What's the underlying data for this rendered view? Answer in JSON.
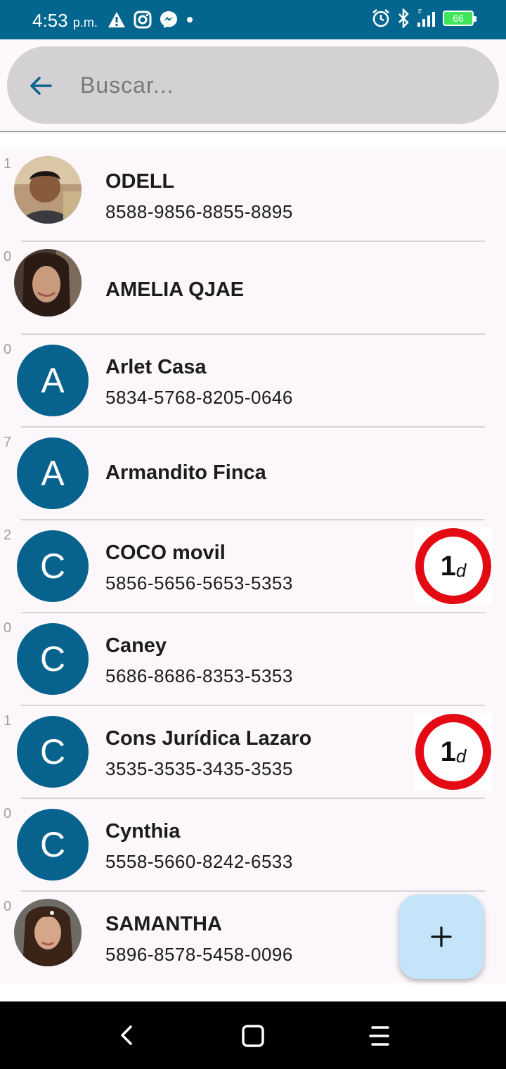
{
  "status_bar": {
    "time": "4:53",
    "ampm": "p.m.",
    "battery": "66",
    "icons": [
      "warning-icon",
      "instagram-icon",
      "messenger-icon",
      "dot-icon",
      "alarm-icon",
      "bluetooth-icon",
      "signal-icon",
      "battery-icon"
    ]
  },
  "search": {
    "placeholder": "Buscar..."
  },
  "contacts": [
    {
      "count": "1",
      "name": "ODELL",
      "phone": "8588-9856-8855-8895",
      "avatar_type": "photo"
    },
    {
      "count": "0",
      "name": "AMELIA QJAE",
      "phone": "",
      "avatar_type": "photo"
    },
    {
      "count": "0",
      "name": "Arlet Casa",
      "phone": "5834-5768-8205-0646",
      "avatar_letter": "A"
    },
    {
      "count": "7",
      "name": "Armandito Finca",
      "phone": "",
      "avatar_letter": "A"
    },
    {
      "count": "2",
      "name": "COCO movil",
      "phone": "5856-5656-5653-5353",
      "avatar_letter": "C",
      "badge_num": "1",
      "badge_unit": "d"
    },
    {
      "count": "0",
      "name": "Caney",
      "phone": "5686-8686-8353-5353",
      "avatar_letter": "C"
    },
    {
      "count": "1",
      "name": "Cons Jurídica Lazaro",
      "phone": "3535-3535-3435-3535",
      "avatar_letter": "C",
      "badge_num": "1",
      "badge_unit": "d"
    },
    {
      "count": "0",
      "name": "Cynthia",
      "phone": "5558-5660-8242-6533",
      "avatar_letter": "C"
    },
    {
      "count": "0",
      "name": "SAMANTHA",
      "phone": "5896-8578-5458-0096",
      "avatar_type": "photo"
    }
  ],
  "fab": {
    "icon": "plus-icon"
  },
  "nav": {
    "icons": [
      "back-icon",
      "home-icon",
      "menu-icon"
    ]
  },
  "colors": {
    "primary": "#03668f",
    "badge_red": "#e30a13",
    "fab": "#c4e4f9"
  }
}
